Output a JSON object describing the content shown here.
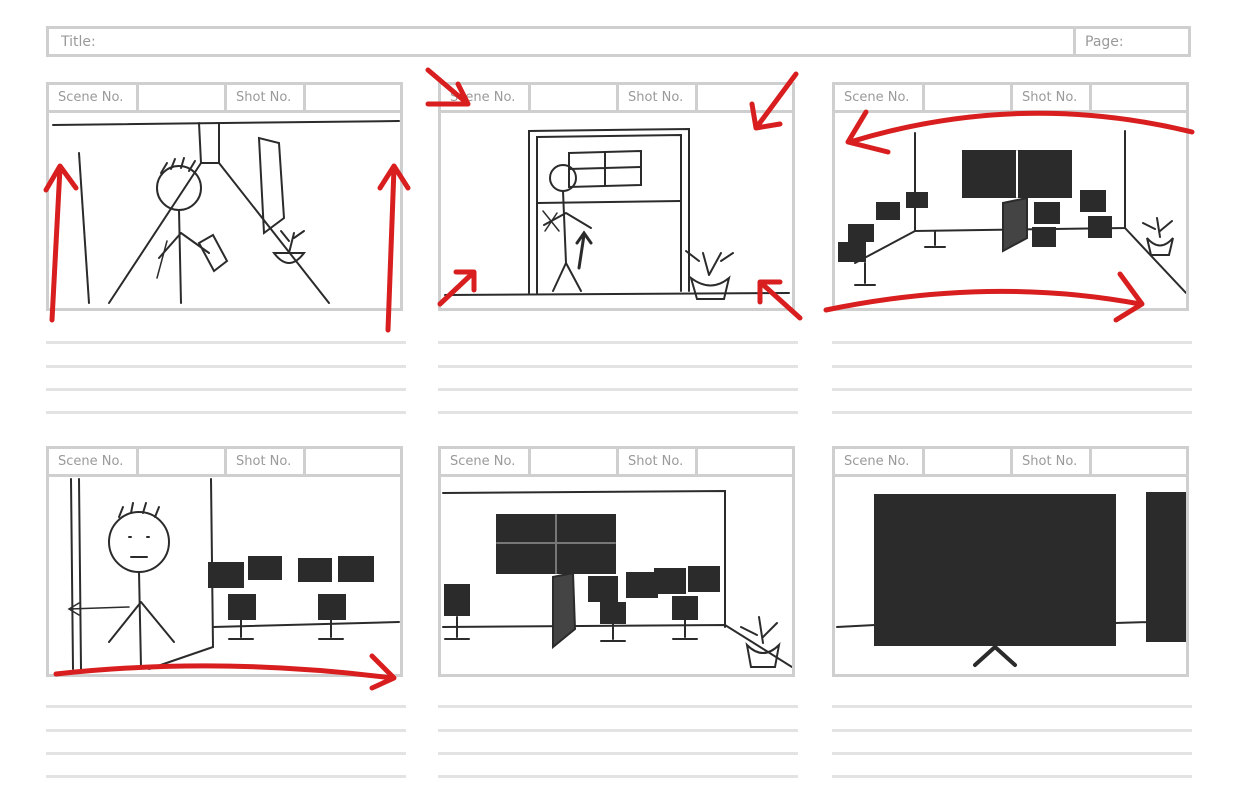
{
  "sheet": {
    "title_label": "Title:",
    "page_label": "Page:"
  },
  "panels": [
    {
      "scene_label": "Scene No.",
      "shot_label": "Shot No."
    },
    {
      "scene_label": "Scene No.",
      "shot_label": "Shot No."
    },
    {
      "scene_label": "Scene No.",
      "shot_label": "Shot No."
    },
    {
      "scene_label": "Scene No.",
      "shot_label": "Shot No."
    },
    {
      "scene_label": "Scene No.",
      "shot_label": "Shot No."
    },
    {
      "scene_label": "Scene No.",
      "shot_label": "Shot No."
    }
  ],
  "colors": {
    "frame_border": "#cfcfcf",
    "label_text": "#9a9a9a",
    "sketch_ink": "#2b2b2b",
    "annotation_red": "#d81e1e"
  }
}
